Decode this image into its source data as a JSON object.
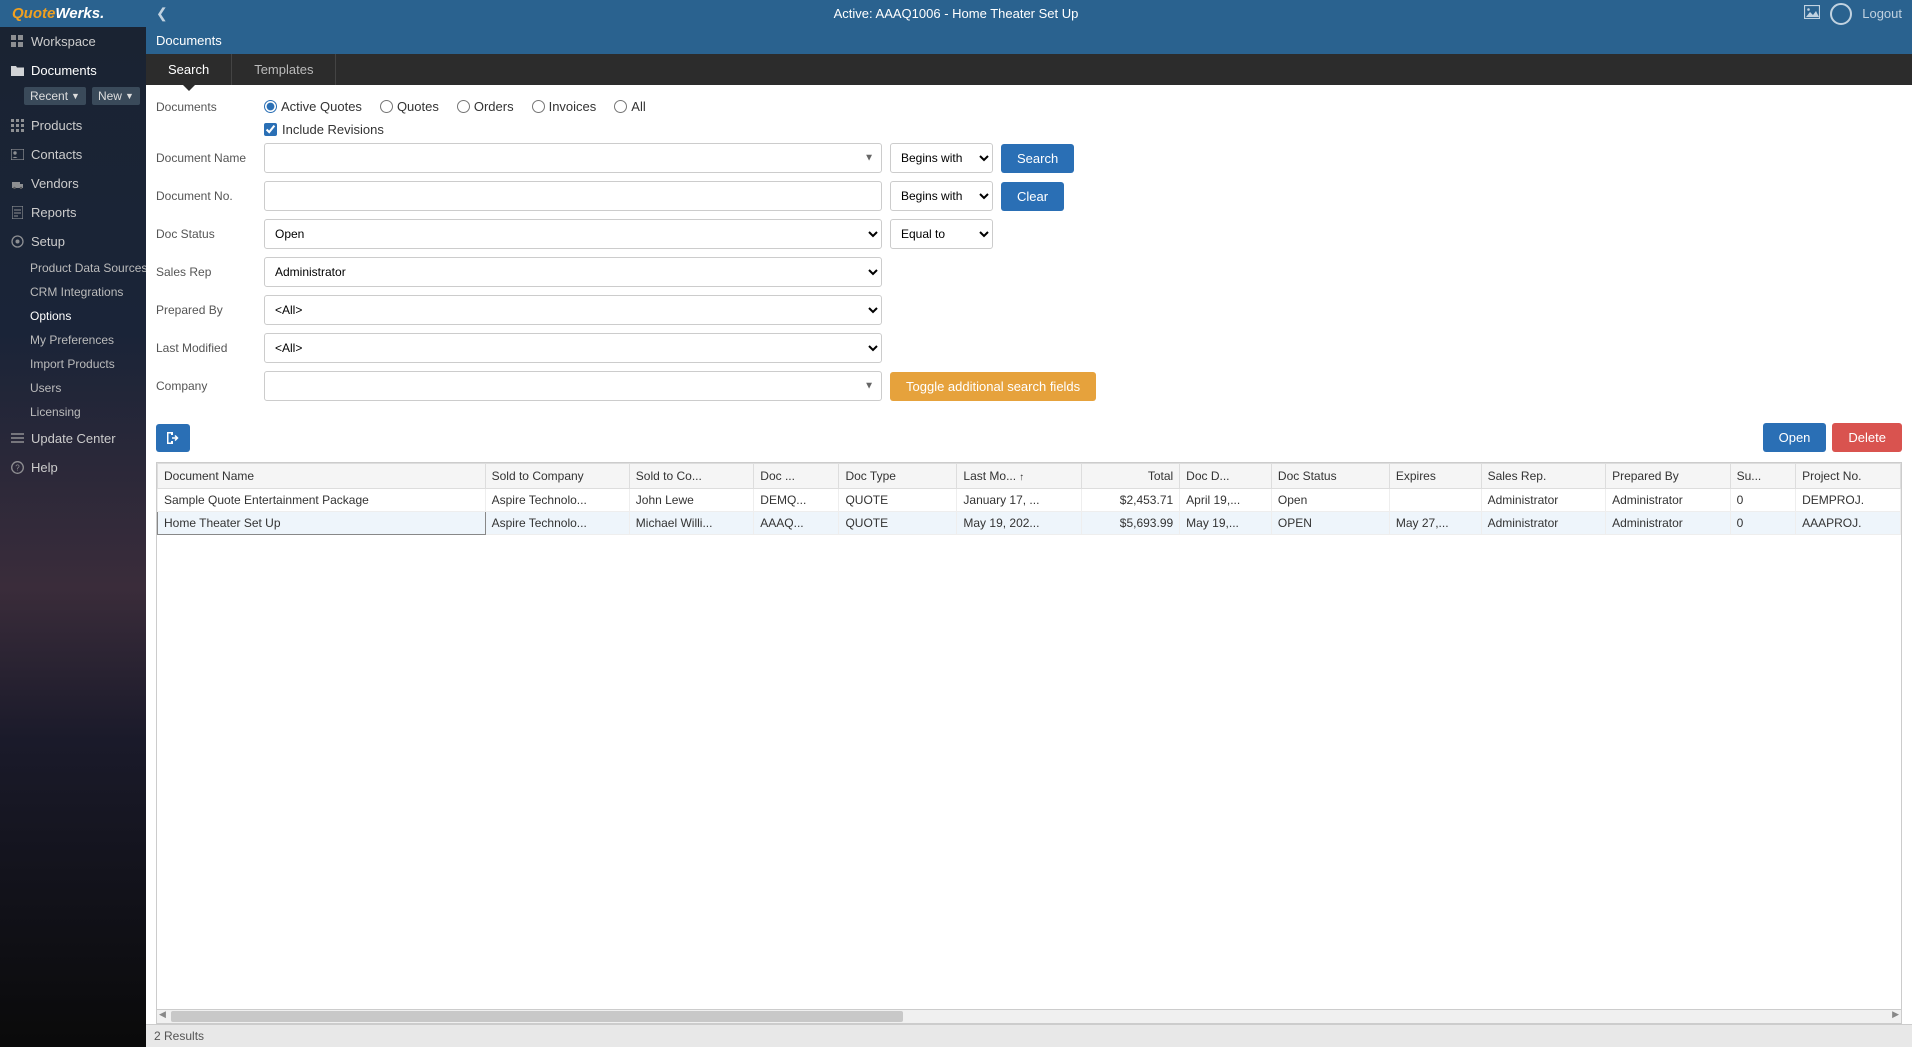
{
  "header": {
    "title": "Active: AAAQ1006 - Home Theater Set Up",
    "logout": "Logout",
    "logo_quote": "Quote",
    "logo_werks": "Werks."
  },
  "sidebar": {
    "workspace": "Workspace",
    "documents": "Documents",
    "recent_btn": "Recent",
    "new_btn": "New",
    "products": "Products",
    "contacts": "Contacts",
    "vendors": "Vendors",
    "reports": "Reports",
    "setup": "Setup",
    "setup_children": {
      "product_data_sources": "Product Data Sources",
      "crm_integrations": "CRM Integrations",
      "options": "Options",
      "my_preferences": "My Preferences",
      "import_products": "Import Products",
      "users": "Users",
      "licensing": "Licensing"
    },
    "update_center": "Update Center",
    "help": "Help"
  },
  "section": {
    "title": "Documents"
  },
  "tabs": {
    "search": "Search",
    "templates": "Templates"
  },
  "form": {
    "documents_label": "Documents",
    "radio_active_quotes": "Active Quotes",
    "radio_quotes": "Quotes",
    "radio_orders": "Orders",
    "radio_invoices": "Invoices",
    "radio_all": "All",
    "include_revisions": "Include Revisions",
    "document_name_label": "Document Name",
    "document_no_label": "Document No.",
    "doc_status_label": "Doc Status",
    "sales_rep_label": "Sales Rep",
    "prepared_by_label": "Prepared By",
    "last_modified_label": "Last Modified",
    "company_label": "Company",
    "begins_with": "Begins with",
    "equal_to": "Equal to",
    "doc_status_value": "Open",
    "sales_rep_value": "Administrator",
    "prepared_by_value": "<All>",
    "last_modified_value": "<All>",
    "search_btn": "Search",
    "clear_btn": "Clear",
    "toggle_btn": "Toggle additional search fields",
    "open_btn": "Open",
    "delete_btn": "Delete"
  },
  "table": {
    "headers": {
      "document_name": "Document Name",
      "sold_to_company": "Sold to Company",
      "sold_to_contact": "Sold to Co...",
      "doc_no": "Doc ...",
      "doc_type": "Doc Type",
      "last_modified": "Last Mo...",
      "total": "Total",
      "doc_date": "Doc D...",
      "doc_status": "Doc Status",
      "expires": "Expires",
      "sales_rep": "Sales Rep.",
      "prepared_by": "Prepared By",
      "su": "Su...",
      "project_no": "Project No."
    },
    "rows": [
      {
        "document_name": "Sample Quote Entertainment Package",
        "sold_to_company": "Aspire Technolo...",
        "sold_to_contact": "John Lewe",
        "doc_no": "DEMQ...",
        "doc_type": "QUOTE",
        "last_modified": "January 17, ...",
        "total": "$2,453.71",
        "doc_date": "April 19,...",
        "doc_status": "Open",
        "expires": "",
        "sales_rep": "Administrator",
        "prepared_by": "Administrator",
        "su": "0",
        "project_no": "DEMPROJ."
      },
      {
        "document_name": "Home Theater Set Up",
        "sold_to_company": "Aspire Technolo...",
        "sold_to_contact": "Michael Willi...",
        "doc_no": "AAAQ...",
        "doc_type": "QUOTE",
        "last_modified": "May 19, 202...",
        "total": "$5,693.99",
        "doc_date": "May 19,...",
        "doc_status": "OPEN",
        "expires": "May 27,...",
        "sales_rep": "Administrator",
        "prepared_by": "Administrator",
        "su": "0",
        "project_no": "AAAPROJ."
      }
    ]
  },
  "status": {
    "results": "2 Results"
  }
}
